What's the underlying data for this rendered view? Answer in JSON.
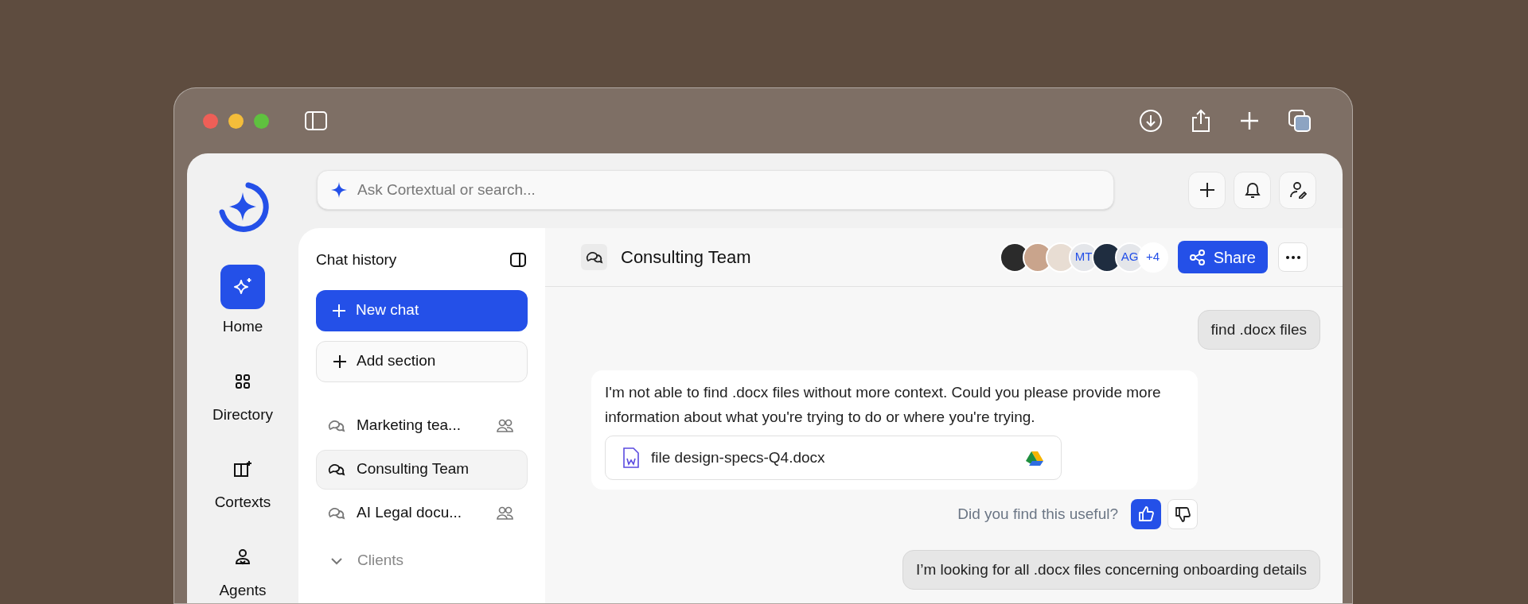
{
  "nav": {
    "items": [
      {
        "label": "Home",
        "selected": true
      },
      {
        "label": "Directory",
        "selected": false
      },
      {
        "label": "Cortexts",
        "selected": false
      },
      {
        "label": "Agents",
        "selected": false
      }
    ]
  },
  "search": {
    "placeholder": "Ask Cortextual or search..."
  },
  "chat_history": {
    "title": "Chat history",
    "new_chat": "New chat",
    "add_section": "Add section",
    "items": [
      {
        "label": "Marketing tea...",
        "shared": true,
        "selected": false
      },
      {
        "label": "Consulting Team",
        "shared": false,
        "selected": true
      },
      {
        "label": "AI Legal docu...",
        "shared": true,
        "selected": false
      }
    ],
    "sections": [
      {
        "label": "Clients",
        "expanded": true
      }
    ]
  },
  "chat": {
    "title": "Consulting Team",
    "members": [
      {
        "kind": "photo",
        "color": "#2b2b2b"
      },
      {
        "kind": "photo",
        "color": "#c9a48c"
      },
      {
        "kind": "photo",
        "color": "#e8ddd3"
      },
      {
        "kind": "initials",
        "text": "MT"
      },
      {
        "kind": "photo",
        "color": "#1f2d40"
      },
      {
        "kind": "initials",
        "text": "AG"
      },
      {
        "kind": "count",
        "text": "+4"
      }
    ],
    "share": "Share",
    "messages": [
      {
        "kind": "user",
        "text": "find .docx files"
      },
      {
        "kind": "assistant",
        "text": "I'm not able to find .docx files without more context. Could you please provide more information about what you're trying to do or where you're trying.",
        "file": "file design-specs-Q4.docx",
        "feedback_prompt": "Did you find this useful?",
        "thumbs_up": true,
        "thumbs_down": false
      },
      {
        "kind": "user",
        "text": "I’m looking for all .docx files concerning onboarding details"
      }
    ]
  }
}
